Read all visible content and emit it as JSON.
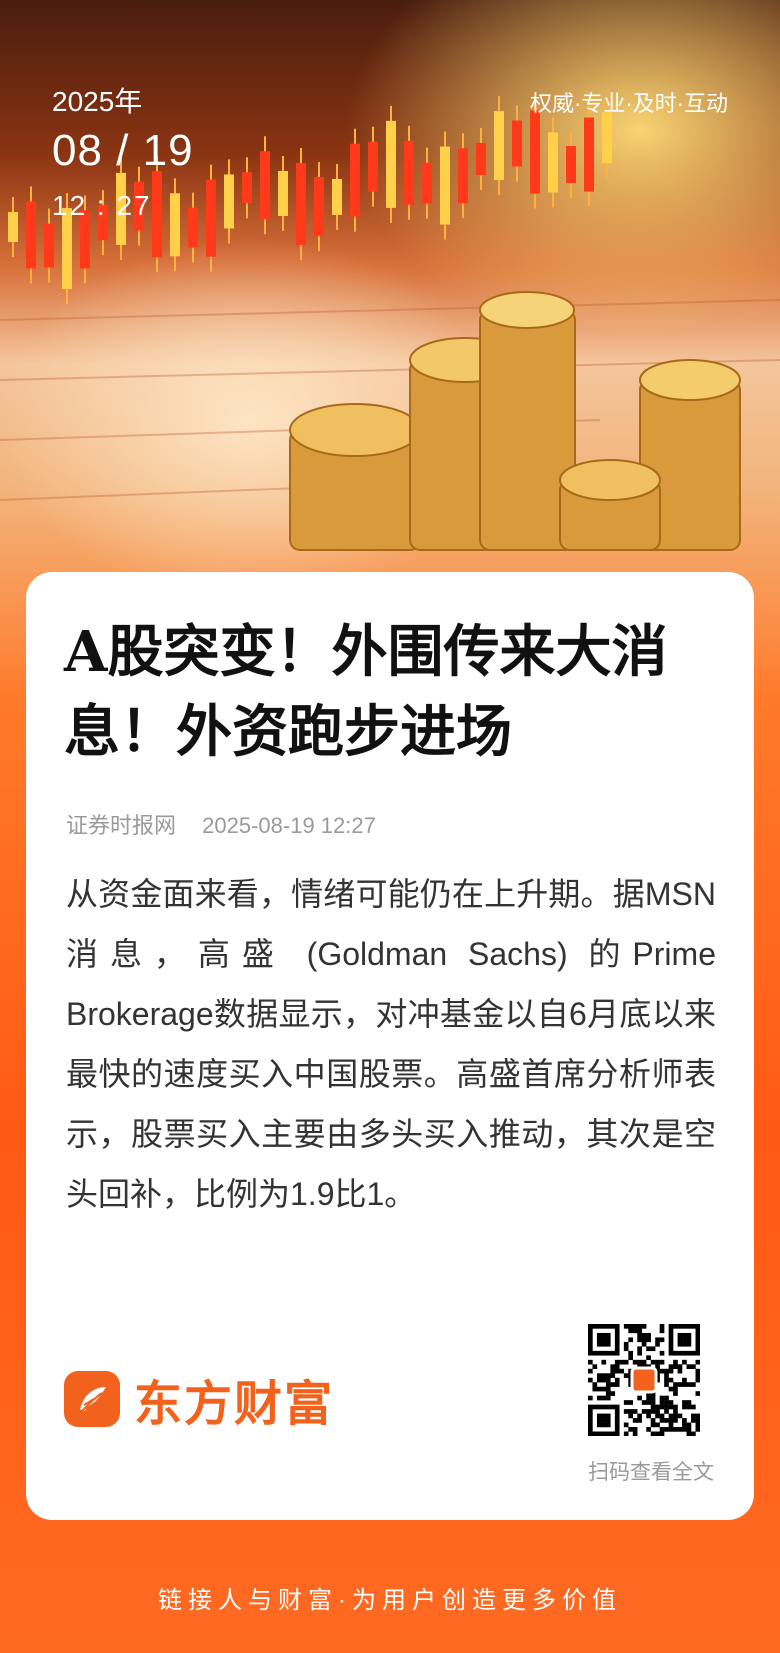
{
  "header": {
    "year": "2025年",
    "month_day": "08 / 19",
    "time": "12 : 27",
    "tagline": "权威·专业·及时·互动"
  },
  "article": {
    "title": "A股突变！外围传来大消息！外资跑步进场",
    "source": "证券时报网",
    "datetime": "2025-08-19 12:27",
    "body": "从资金面来看，情绪可能仍在上升期。据MSN消息，高盛 (Goldman Sachs) 的Prime Brokerage数据显示，对冲基金以自6月底以来最快的速度买入中国股票。高盛首席分析师表示，股票买入主要由多头买入推动，其次是空头回补，比例为1.9比1。"
  },
  "brand": {
    "name": "东方财富",
    "logo_icon": "feather-swoosh-icon",
    "color": "#f2621d"
  },
  "qr": {
    "caption": "扫码查看全文"
  },
  "footer": {
    "slogan": "链接人与财富·为用户创造更多价值"
  },
  "colors": {
    "accent": "#ff6a1e",
    "title": "#111111",
    "meta": "#9a9a9a"
  }
}
